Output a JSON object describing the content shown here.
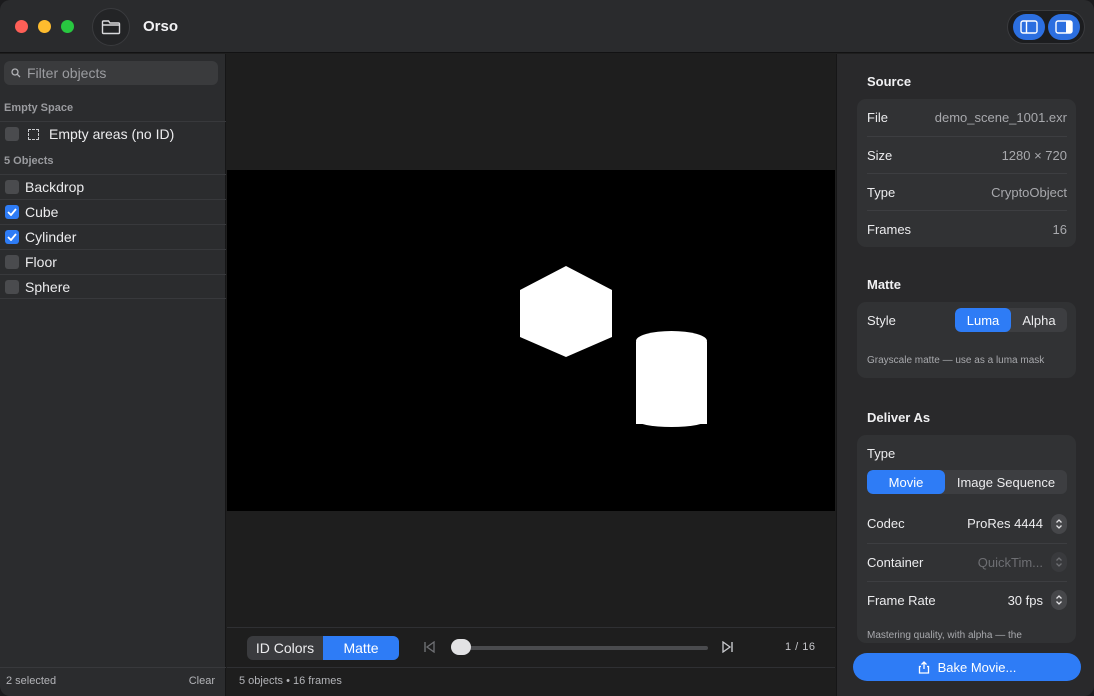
{
  "window": {
    "title": "Orso"
  },
  "sidebar": {
    "filter_placeholder": "Filter objects",
    "sections": [
      {
        "header": "Empty Space",
        "items": [
          {
            "label": "Empty areas (no ID)",
            "checked": false
          }
        ]
      },
      {
        "header": "5 Objects",
        "items": [
          {
            "label": "Backdrop",
            "checked": false
          },
          {
            "label": "Cube",
            "checked": true
          },
          {
            "label": "Cylinder",
            "checked": true
          },
          {
            "label": "Floor",
            "checked": false
          },
          {
            "label": "Sphere",
            "checked": false
          }
        ]
      }
    ],
    "footer": {
      "selected": "2 selected",
      "clear": "Clear"
    }
  },
  "viewer": {
    "mode_tabs": [
      {
        "label": "ID Colors",
        "active": false
      },
      {
        "label": "Matte",
        "active": true
      }
    ],
    "frame_counter": "1 / 16",
    "scrub_position": 0.0,
    "status": "5 objects • 16 frames"
  },
  "inspector": {
    "source": {
      "title": "Source",
      "rows": [
        {
          "key": "File",
          "value": "demo_scene_1001.exr"
        },
        {
          "key": "Size",
          "value": "1280 × 720"
        },
        {
          "key": "Type",
          "value": "CryptoObject"
        },
        {
          "key": "Frames",
          "value": "16"
        }
      ]
    },
    "matte": {
      "title": "Matte",
      "style_label": "Style",
      "style_options": [
        {
          "label": "Luma",
          "active": true
        },
        {
          "label": "Alpha",
          "active": false
        }
      ],
      "hint": "Grayscale matte — use as a luma mask"
    },
    "deliver": {
      "title": "Deliver As",
      "type_label": "Type",
      "type_options": [
        {
          "label": "Movie",
          "active": true
        },
        {
          "label": "Image Sequence",
          "active": false
        }
      ],
      "codec_label": "Codec",
      "codec_value": "ProRes 4444",
      "container_label": "Container",
      "container_value": "QuickTim...",
      "framerate_label": "Frame Rate",
      "framerate_value": "30 fps",
      "note": "Mastering quality, with alpha — the"
    },
    "bake_button": "Bake Movie..."
  },
  "colors": {
    "accent": "#2e7cf6",
    "window_bg": "#1e1e1e",
    "sidebar_bg": "#2b2c2e",
    "inspector_bg": "#29292b",
    "card_bg": "#313234"
  },
  "icons": [
    "folder-icon",
    "sidebar-left-icon",
    "sidebar-right-icon",
    "search-icon",
    "checkmark-icon",
    "dashed-selection-icon",
    "step-back-icon",
    "step-forward-icon",
    "chevron-updown-icon",
    "export-icon"
  ]
}
